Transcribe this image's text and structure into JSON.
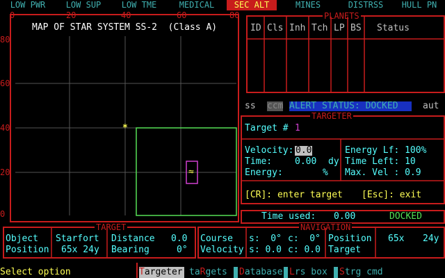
{
  "status_bar": [
    "LOW PWR",
    "LOW SUP",
    "LOW TME",
    "MEDICAL",
    "SEC ALT",
    "MINES",
    "DISTRSS",
    "HULL PN"
  ],
  "map": {
    "title": "MAP OF STAR SYSTEM SS-2  (Class A)",
    "x_ticks": [
      "0",
      "20",
      "40",
      "60",
      "80"
    ],
    "y_ticks": [
      "80",
      "60",
      "40",
      "20",
      "0"
    ],
    "ship_glyph": "*",
    "starfort_glyph": "≈"
  },
  "planets": {
    "label": "PLANETS",
    "columns": [
      "ID",
      "Cls",
      "Inh",
      "Tch",
      "LP",
      "BS",
      "Status"
    ]
  },
  "alert_row": {
    "ss": "ss",
    "ccm": "ccm",
    "alert": "ALERT STATUS: DOCKED",
    "aut": "aut"
  },
  "targeter": {
    "label": "TARGETER",
    "target_label": "Target #",
    "target_num": "1",
    "velocity_label": "Velocity:",
    "velocity_value": "0.0",
    "time_label": "Time:",
    "time_value": "0.00",
    "time_unit": "dy",
    "energy_label": "Energy:",
    "energy_unit": "%",
    "energy_lf": "Energy Lf: 100%",
    "time_left": "Time Left: 10",
    "max_vel": "Max. Vel : 0.9",
    "cr_hint": "[CR]: enter target",
    "esc_hint": "[Esc]: exit"
  },
  "time_used": {
    "label": "Time used:",
    "value": "0.00",
    "status": "DOCKED"
  },
  "target_panel": {
    "label": "TARGET",
    "object_label": "Object",
    "object_value": "Starfort",
    "position_label": "Position",
    "position_value": "65x 24y",
    "distance_label": "Distance",
    "distance_value": "0.0",
    "bearing_label": "Bearing",
    "bearing_value": "0°"
  },
  "navigation": {
    "label": "NAVIGATION",
    "course_label": "Course",
    "course_s": "s:  0°",
    "course_c": "c:  0°",
    "velocity_label": "Velocity",
    "velocity_s": "s: 0.0",
    "velocity_c": "c: 0.0",
    "position_label": "Position",
    "position_x": "65x",
    "position_y": "24y",
    "target_label": "Target"
  },
  "footer": {
    "prompt": "Select option",
    "menu": [
      {
        "hot": "T",
        "rest": "argeter"
      },
      {
        "pre": "ta",
        "hot": "R",
        "rest": "gets"
      },
      {
        "hot": "D",
        "rest": "atabase"
      },
      {
        "hot": "L",
        "rest": "rs box"
      },
      {
        "hot": "S",
        "rest": "trg cmd"
      }
    ]
  },
  "colors": {
    "frame_red": "#c81c1c",
    "teal": "#40b0b0",
    "yellow": "#ffff55",
    "green": "#55e055",
    "magenta": "#d040d0",
    "alert_blue": "#1830c0"
  }
}
